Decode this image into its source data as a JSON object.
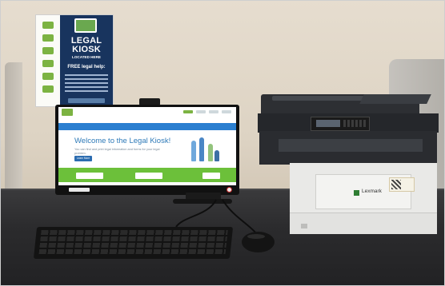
{
  "poster": {
    "title": "LEGAL KIOSK",
    "subtitle": "LOCATED HERE",
    "help_heading": "FREE legal help:",
    "colors": {
      "navy": "#18345e",
      "accent": "#7cb342"
    }
  },
  "kiosk_screen": {
    "hero_title": "Welcome to the Legal Kiosk!",
    "hero_text": "You can find and print legal information and forms for your legal problem.",
    "learn_more": "Learn More",
    "colors": {
      "banner": "#2b7fd0",
      "band": "#6cc03a",
      "title": "#2e7ab8"
    }
  },
  "printer": {
    "brand": "Lexmark"
  }
}
